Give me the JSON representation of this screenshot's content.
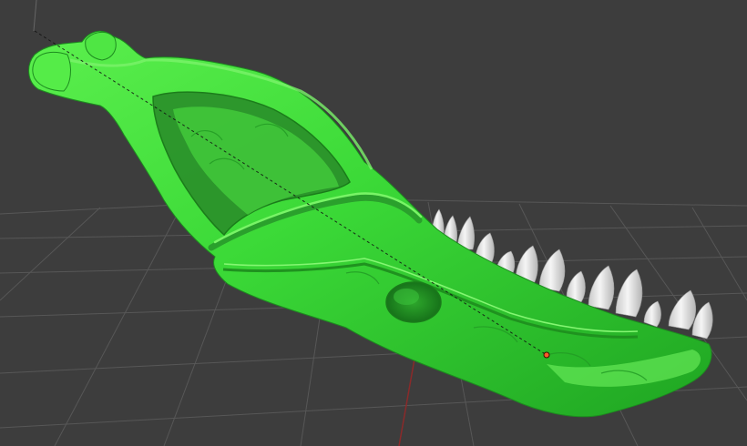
{
  "viewport": {
    "background_color": "#3d3d3d",
    "grid_color": "#575757",
    "axis_color": "#8a2a2a",
    "model_color": "#39d93a",
    "model_shadow_color": "#1e9a20",
    "model_highlight_color": "#8af57a",
    "teeth_color": "#e6e6e6",
    "measure_line": "dashed",
    "measure_point_color": "#ff5a2a"
  },
  "icons": {
    "model": "skull-jaw-model-icon",
    "teeth": "tooth-icon",
    "grid": "grid-floor",
    "axis": "z-axis-line",
    "measure": "measure-line",
    "point": "measure-point-marker"
  }
}
